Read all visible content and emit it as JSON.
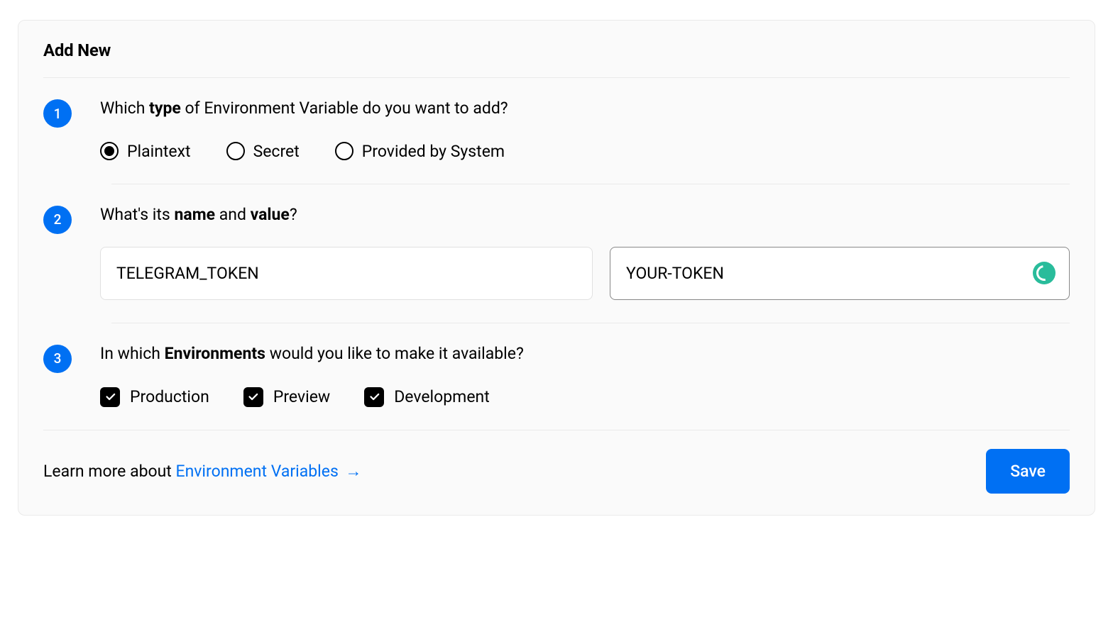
{
  "header": {
    "title": "Add New"
  },
  "step1": {
    "number": "1",
    "question_pre": "Which ",
    "question_bold": "type",
    "question_post": " of Environment Variable do you want to add?",
    "options": [
      {
        "label": "Plaintext",
        "selected": true
      },
      {
        "label": "Secret",
        "selected": false
      },
      {
        "label": "Provided by System",
        "selected": false
      }
    ]
  },
  "step2": {
    "number": "2",
    "question_pre": "What's its ",
    "question_bold1": "name",
    "question_mid": " and ",
    "question_bold2": "value",
    "question_post": "?",
    "name_value": "TELEGRAM_TOKEN",
    "value_value": "YOUR-TOKEN"
  },
  "step3": {
    "number": "3",
    "question_pre": "In which ",
    "question_bold": "Environments",
    "question_post": " would you like to make it available?",
    "options": [
      {
        "label": "Production",
        "checked": true
      },
      {
        "label": "Preview",
        "checked": true
      },
      {
        "label": "Development",
        "checked": true
      }
    ]
  },
  "footer": {
    "learn_pre": "Learn more about ",
    "learn_link": "Environment Variables",
    "save": "Save"
  }
}
